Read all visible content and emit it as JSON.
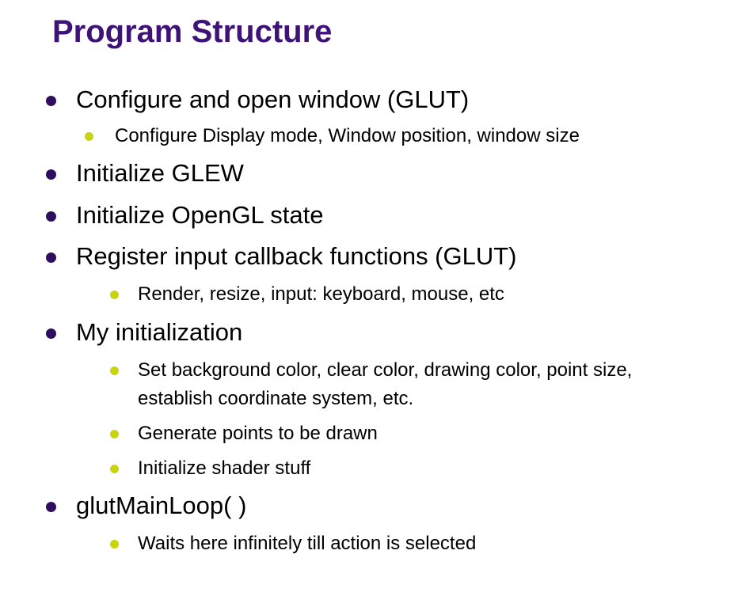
{
  "title": "Program Structure",
  "accent_colors": {
    "title": "#3f1278",
    "level1_bullet": "#2e0f5e",
    "level2_bullet": "#c9d40e"
  },
  "items": [
    {
      "level": 1,
      "text": "Configure and open window (GLUT)"
    },
    {
      "level": 2,
      "text": "Configure Display mode, Window position, window size"
    },
    {
      "level": 1,
      "text": "Initialize GLEW"
    },
    {
      "level": 1,
      "text": "Initialize OpenGL state"
    },
    {
      "level": 1,
      "text": "Register input callback functions (GLUT)"
    },
    {
      "level": 2,
      "text": "Render, resize, input: keyboard, mouse, etc"
    },
    {
      "level": 1,
      "text": "My initialization"
    },
    {
      "level": 2,
      "text": "Set background color, clear color, drawing color, point size,",
      "continuation": "establish coordinate system, etc."
    },
    {
      "level": 2,
      "text": "Generate points to be drawn"
    },
    {
      "level": 2,
      "text": "Initialize shader stuff"
    },
    {
      "level": 1,
      "text": "glutMainLoop( )"
    },
    {
      "level": 2,
      "text": "Waits here infinitely till action is selected"
    }
  ]
}
